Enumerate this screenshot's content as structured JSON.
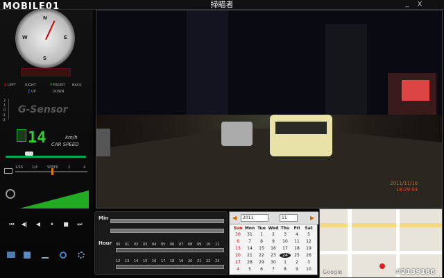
{
  "app": {
    "title": "掃瞄者",
    "logo": "MOBILE01",
    "minimize": "_",
    "close": "X"
  },
  "compass": {
    "n": "N",
    "s": "S",
    "e": "E",
    "w": "W"
  },
  "directions": {
    "left": "LEFT",
    "right": "RIGHT",
    "front": "FRONT",
    "back": "BACK",
    "up": "UP",
    "down": "DOWN",
    "x": "X",
    "y": "Y",
    "z": "Z"
  },
  "gsensor": {
    "label": "G-Sensor",
    "ticks": [
      "2",
      "1",
      "0",
      "-1",
      "-2"
    ]
  },
  "speed": {
    "value": "14",
    "unit": "km/h",
    "label": "CAR SPEED"
  },
  "playback": {
    "speed_label": "SPEED",
    "ticks": [
      "1/16",
      "1/4",
      "2",
      "4"
    ]
  },
  "controls": [
    "⏮",
    "◀|",
    "◀",
    "⏸",
    "■",
    "⏭"
  ],
  "video": {
    "date": "2011/11/16",
    "time": "18:29:54"
  },
  "timeline": {
    "min_label": "Min",
    "hour_label": "Hour",
    "hours_row1": [
      "00",
      "01",
      "02",
      "03",
      "04",
      "05",
      "06",
      "07",
      "08",
      "09",
      "10",
      "11"
    ],
    "hours_row2": [
      "12",
      "13",
      "14",
      "15",
      "16",
      "17",
      "18",
      "19",
      "20",
      "21",
      "22",
      "23"
    ]
  },
  "calendar": {
    "year": "2011",
    "month": "11",
    "weekdays": [
      "Sun",
      "Mon",
      "Tue",
      "Wed",
      "Thu",
      "Fri",
      "Sat"
    ],
    "rows": [
      [
        "30",
        "31",
        "1",
        "2",
        "3",
        "4",
        "5"
      ],
      [
        "6",
        "7",
        "8",
        "9",
        "10",
        "11",
        "12"
      ],
      [
        "13",
        "14",
        "15",
        "16",
        "17",
        "18",
        "19"
      ],
      [
        "20",
        "21",
        "22",
        "23",
        "24",
        "25",
        "26"
      ],
      [
        "27",
        "28",
        "29",
        "30",
        "1",
        "2",
        "3"
      ],
      [
        "4",
        "5",
        "6",
        "7",
        "8",
        "9",
        "10"
      ]
    ],
    "selected": "24"
  },
  "map": {
    "label": "Google"
  },
  "watermark": "#2139186",
  "colors": {
    "speed_green": "#33cc33",
    "timestamp": "#d45a2a",
    "accent_orange": "#dd7700"
  }
}
